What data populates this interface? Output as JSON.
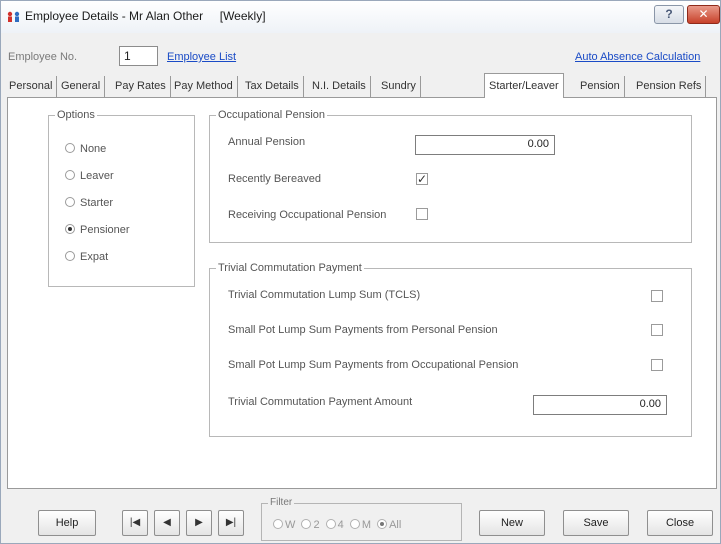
{
  "window": {
    "title": "Employee Details - Mr Alan Other     [Weekly]",
    "help_button": "?",
    "close_button": "✕"
  },
  "employee": {
    "label": "Employee No.",
    "number": "1",
    "list_link": "Employee List",
    "auto_absence_link": "Auto Absence Calculation"
  },
  "tabs": [
    {
      "label": "Personal"
    },
    {
      "label": "General"
    },
    {
      "label": "Pay Rates"
    },
    {
      "label": "Pay Method"
    },
    {
      "label": "Tax Details"
    },
    {
      "label": "N.I. Details"
    },
    {
      "label": "Sundry"
    },
    {
      "label": "Starter/Leaver",
      "active": true
    },
    {
      "label": "Pension"
    },
    {
      "label": "Pension Refs"
    }
  ],
  "options": {
    "legend": "Options",
    "items": [
      {
        "label": "None",
        "selected": false
      },
      {
        "label": "Leaver",
        "selected": false
      },
      {
        "label": "Starter",
        "selected": false
      },
      {
        "label": "Pensioner",
        "selected": true
      },
      {
        "label": "Expat",
        "selected": false
      }
    ]
  },
  "occupational_pension": {
    "legend": "Occupational Pension",
    "annual_pension_label": "Annual Pension",
    "annual_pension_value": "0.00",
    "recently_bereaved_label": "Recently Bereaved",
    "recently_bereaved_checked": true,
    "receiving_label": "Receiving Occupational Pension",
    "receiving_checked": false
  },
  "trivial_commutation": {
    "legend": "Trivial Commutation Payment",
    "tcls_label": "Trivial Commutation Lump Sum (TCLS)",
    "tcls_checked": false,
    "small_pot_personal_label": "Small Pot Lump Sum Payments from Personal Pension",
    "small_pot_personal_checked": false,
    "small_pot_occupational_label": "Small Pot Lump Sum Payments from Occupational Pension",
    "small_pot_occupational_checked": false,
    "amount_label": "Trivial Commutation Payment Amount",
    "amount_value": "0.00"
  },
  "bottom": {
    "help": "Help",
    "first": "|◀",
    "prev": "◀",
    "next": "▶",
    "last": "▶|",
    "filter_legend": "Filter",
    "filter_options": [
      {
        "label": "W",
        "selected": false
      },
      {
        "label": "2",
        "selected": false
      },
      {
        "label": "4",
        "selected": false
      },
      {
        "label": "M",
        "selected": false
      },
      {
        "label": "All",
        "selected": true
      }
    ],
    "new": "New",
    "save": "Save",
    "close": "Close"
  }
}
